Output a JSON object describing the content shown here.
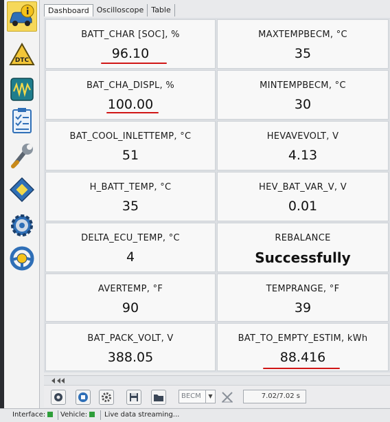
{
  "tabs": [
    {
      "label": "Dashboard"
    },
    {
      "label": "Oscilloscope"
    },
    {
      "label": "Table"
    }
  ],
  "cells": [
    {
      "label": "BATT_CHAR [SOC], %",
      "value": "96.10",
      "underlined": true
    },
    {
      "label": "MAXTEMPBECM, °C",
      "value": "35"
    },
    {
      "label": "BAT_CHA_DISPL, %",
      "value": "100.00",
      "underlined": true
    },
    {
      "label": "MINTEMPBECM, °C",
      "value": "30"
    },
    {
      "label": "BAT_COOL_INLETTEMP, °C",
      "value": "51"
    },
    {
      "label": "HEVAVEVOLT, V",
      "value": "4.13"
    },
    {
      "label": "H_BATT_TEMP, °C",
      "value": "35"
    },
    {
      "label": "HEV_BAT_VAR_V, V",
      "value": "0.01"
    },
    {
      "label": "DELTA_ECU_TEMP, °C",
      "value": "4"
    },
    {
      "label": "REBALANCE",
      "value": "Successfully"
    },
    {
      "label": "AVERTEMP, °F",
      "value": "90"
    },
    {
      "label": "TEMPRANGE, °F",
      "value": "39"
    },
    {
      "label": "BAT_PACK_VOLT, V",
      "value": "388.05"
    },
    {
      "label": "BAT_TO_EMPTY_ESTIM, kWh",
      "value": "88.416",
      "underlined": true
    }
  ],
  "sidebar": {
    "dtc_label": "DTC",
    "items": [
      {
        "icon": "car-info-icon"
      },
      {
        "icon": "dtc-warning-icon"
      },
      {
        "icon": "oscilloscope-icon"
      },
      {
        "icon": "checklist-icon"
      },
      {
        "icon": "wrench-icon"
      },
      {
        "icon": "chip-icon"
      },
      {
        "icon": "gear-icon"
      },
      {
        "icon": "steering-wheel-icon"
      }
    ]
  },
  "toolbar": {
    "module_select": "BECM",
    "time_readout": "7.02/7.02 s"
  },
  "status": {
    "interface_label": "Interface:",
    "vehicle_label": "Vehicle:",
    "message": "Live data streaming..."
  },
  "colors": {
    "underline": "#d01515",
    "active_icon_bg": "#f6d85a",
    "status_ok": "#2e9e3a"
  }
}
